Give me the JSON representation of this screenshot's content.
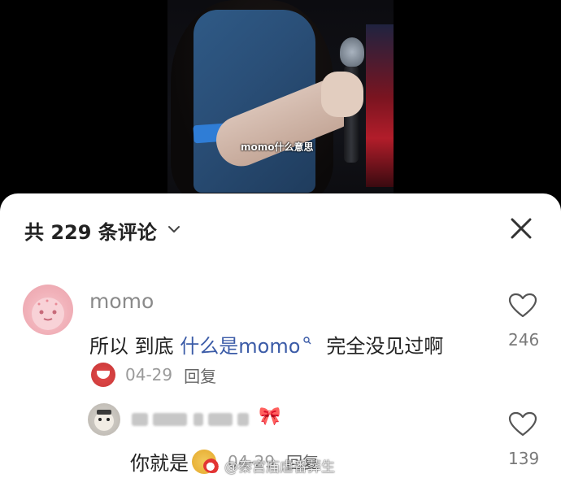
{
  "video": {
    "caption": "momo什么意思"
  },
  "comments_panel": {
    "title": "共 229 条评论"
  },
  "comment": {
    "username": "momo",
    "text_part1": "所以  到底 ",
    "text_highlight": "什么是momo",
    "text_part2": "完全没见过啊",
    "date": "04-29",
    "reply_label": "回复",
    "like_count": "246"
  },
  "reply": {
    "username_masked": "",
    "text": "你就是",
    "date": "04-29",
    "reply_label": "回复",
    "like_count": "139"
  },
  "watermark": {
    "text": "@秦宫庙虐番葬生"
  },
  "colors": {
    "highlight": "#3b5ba7",
    "text_primary": "#222222",
    "text_secondary": "#9a9a9a"
  }
}
